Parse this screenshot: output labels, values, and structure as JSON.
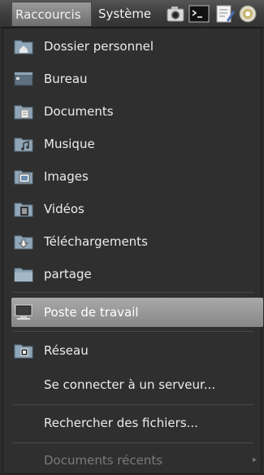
{
  "topbar": {
    "menus": [
      "Raccourcis",
      "Système"
    ],
    "tray_icons": [
      "camera-icon",
      "terminal-icon",
      "text-editor-icon",
      "software-update-icon"
    ]
  },
  "places": {
    "items": [
      {
        "label": "Dossier personnel",
        "icon": "home-folder-icon"
      },
      {
        "label": "Bureau",
        "icon": "desktop-icon"
      },
      {
        "label": "Documents",
        "icon": "documents-folder-icon"
      },
      {
        "label": "Musique",
        "icon": "music-folder-icon"
      },
      {
        "label": "Images",
        "icon": "pictures-folder-icon"
      },
      {
        "label": "Vidéos",
        "icon": "videos-folder-icon"
      },
      {
        "label": "Téléchargements",
        "icon": "downloads-folder-icon"
      },
      {
        "label": "partage",
        "icon": "folder-icon"
      },
      {
        "label": "Poste de travail",
        "icon": "computer-icon"
      },
      {
        "label": "Réseau",
        "icon": "network-icon"
      }
    ],
    "connect_label": "Se connecter à un serveur...",
    "search_label": "Rechercher des fichiers...",
    "recent_label": "Documents récents",
    "recent_arrow": "▸",
    "highlighted": "Poste de travail",
    "colors": {
      "highlight": "#9c9c9c",
      "menu_bg": "#2f2f2f",
      "folder": "#8fa6b8"
    }
  }
}
